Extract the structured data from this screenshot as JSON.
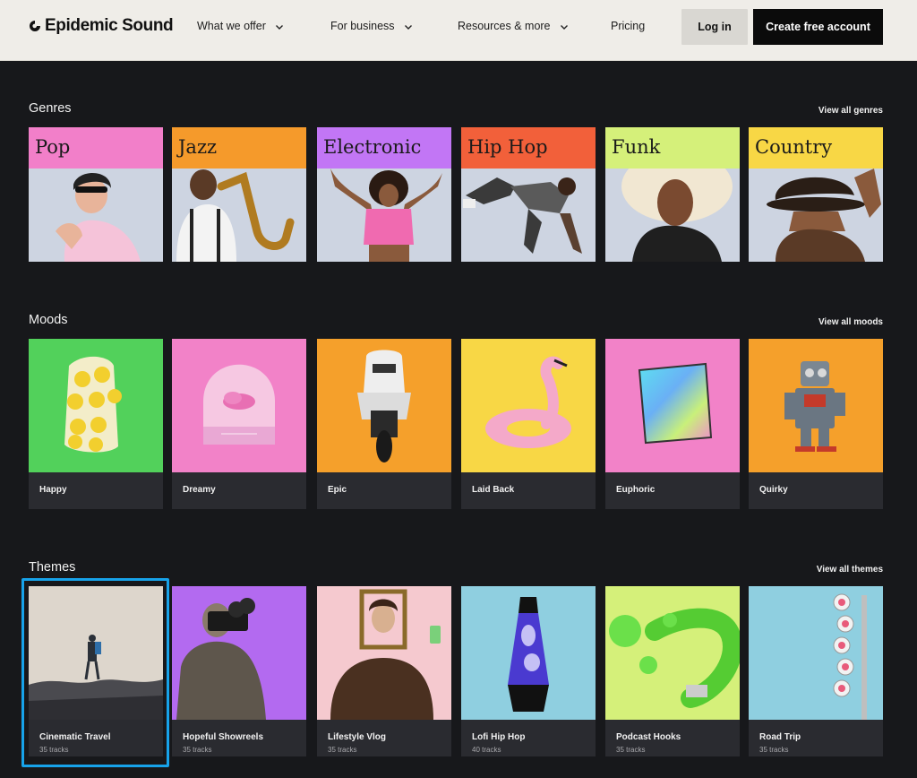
{
  "header": {
    "logo_text": "Epidemic Sound",
    "nav": [
      {
        "label": "What we offer",
        "has_dropdown": true
      },
      {
        "label": "For business",
        "has_dropdown": true
      },
      {
        "label": "Resources & more",
        "has_dropdown": true
      },
      {
        "label": "Pricing",
        "has_dropdown": false
      }
    ],
    "login_label": "Log in",
    "create_label": "Create free account"
  },
  "genres": {
    "title": "Genres",
    "view_all": "View all genres",
    "items": [
      {
        "label": "Pop",
        "color": "#f27fc9"
      },
      {
        "label": "Jazz",
        "color": "#f59a2b"
      },
      {
        "label": "Electronic",
        "color": "#c276f5"
      },
      {
        "label": "Hip Hop",
        "color": "#f2603a"
      },
      {
        "label": "Funk",
        "color": "#d5f07a"
      },
      {
        "label": "Country",
        "color": "#f8d745"
      }
    ]
  },
  "moods": {
    "title": "Moods",
    "view_all": "View all moods",
    "items": [
      {
        "label": "Happy",
        "color": "#52d15b"
      },
      {
        "label": "Dreamy",
        "color": "#f282c8"
      },
      {
        "label": "Epic",
        "color": "#f5a02b"
      },
      {
        "label": "Laid Back",
        "color": "#f8d745"
      },
      {
        "label": "Euphoric",
        "color": "#f282c8"
      },
      {
        "label": "Quirky",
        "color": "#f5a02b"
      }
    ]
  },
  "themes": {
    "title": "Themes",
    "view_all": "View all themes",
    "items": [
      {
        "label": "Cinematic Travel",
        "tracks": "35 tracks",
        "color": "#ddd6cc"
      },
      {
        "label": "Hopeful Showreels",
        "tracks": "35 tracks",
        "color": "#b36af0"
      },
      {
        "label": "Lifestyle Vlog",
        "tracks": "35 tracks",
        "color": "#f5c9cf"
      },
      {
        "label": "Lofi Hip Hop",
        "tracks": "40 tracks",
        "color": "#8fcfe0"
      },
      {
        "label": "Podcast Hooks",
        "tracks": "35 tracks",
        "color": "#d5f07a"
      },
      {
        "label": "Road Trip",
        "tracks": "35 tracks",
        "color": "#8fcfe0"
      }
    ]
  },
  "icons": [
    "epidemic-logo-icon",
    "chevron-down-icon"
  ],
  "colors": {
    "highlight": "#17a3ea",
    "background": "#17181b",
    "header_bg": "#efede8"
  }
}
